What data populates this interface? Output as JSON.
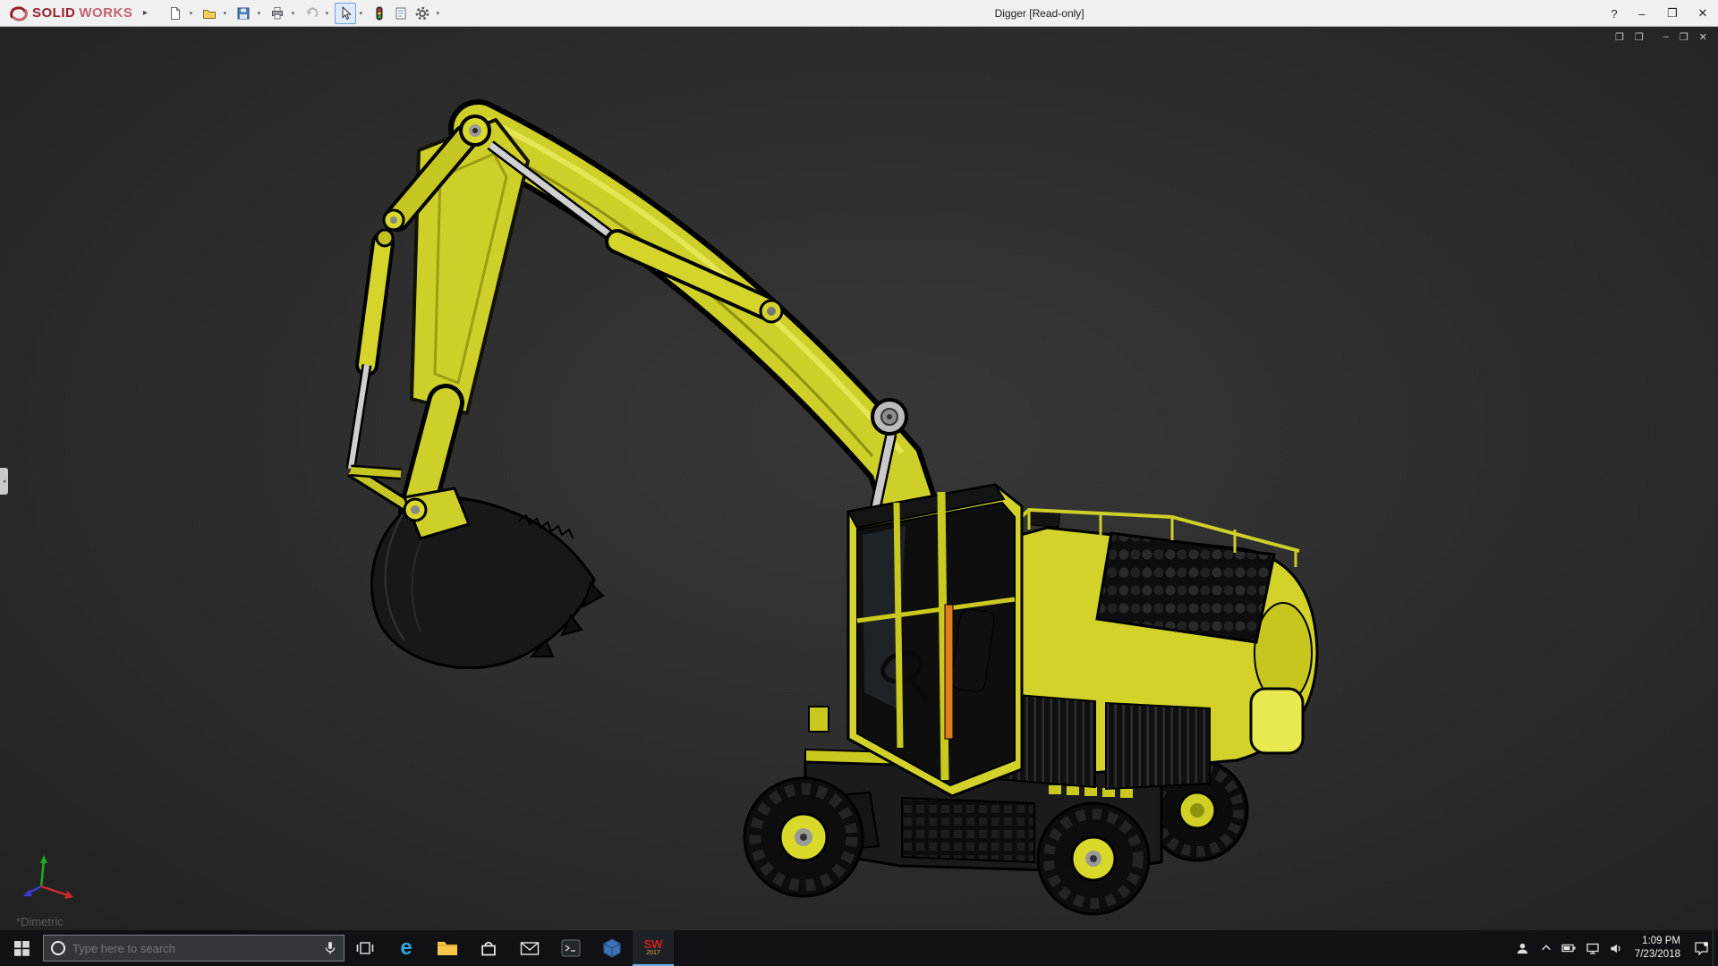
{
  "colors": {
    "titlebar_bg": "#f0f0f0",
    "viewport_bg": "#2b2b2b",
    "taskbar_bg": "#101114",
    "machine_yellow": "#d2d22b",
    "logo_red": "#9a1f2d",
    "hydraulic_orange": "#e07b1e"
  },
  "icons": {
    "caret": "▾",
    "flyout": "▸",
    "edge_tab": "◂"
  },
  "titlebar": {
    "logo": {
      "solid": "SOLID",
      "works": "WORKS"
    },
    "title": "Digger [Read-only]",
    "toolbar_icons": [
      "new-document",
      "open",
      "save",
      "print",
      "undo",
      "select",
      "rebuild-stoplight",
      "file-properties",
      "options-gear"
    ],
    "controls": {
      "help": "?",
      "minimize": "–",
      "maximize": "❐",
      "close": "✕"
    }
  },
  "viewport": {
    "view_label": "*Dimetric",
    "doc_controls": [
      "❐",
      "❐",
      "–",
      "❐",
      "✕"
    ],
    "model": "yellow wheeled excavator with raised boom and bucket",
    "orientation_triad": [
      "x-red",
      "y-green",
      "z-blue"
    ]
  },
  "taskbar": {
    "search_placeholder": "Type here to search",
    "apps": [
      "start",
      "search",
      "task-view",
      "edge",
      "file-explorer",
      "store",
      "mail",
      "console",
      "edrawings",
      "solidworks-2017"
    ],
    "solidworks_badge": {
      "mark": "SW",
      "year": "2017"
    },
    "tray_icons": [
      "user",
      "chevron-up",
      "battery",
      "network",
      "volume",
      "action-center"
    ],
    "clock": {
      "time": "1:09 PM",
      "date": "7/23/2018"
    }
  }
}
